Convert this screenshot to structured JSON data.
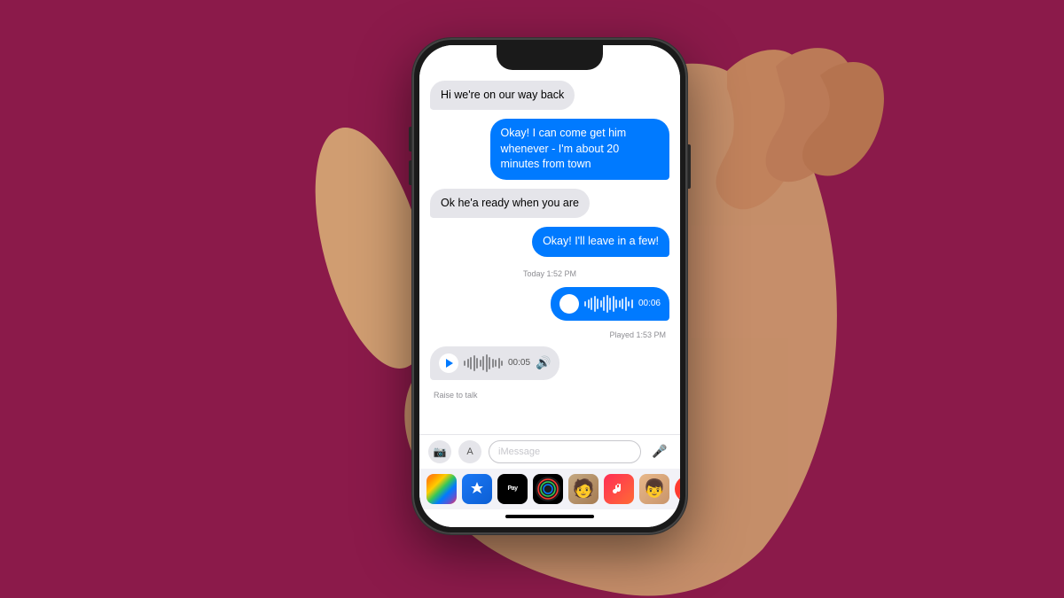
{
  "background": {
    "color": "#8B1A4A"
  },
  "phone": {
    "messages": [
      {
        "id": "msg1",
        "type": "incoming",
        "text": "Hi we're on our way back"
      },
      {
        "id": "msg2",
        "type": "outgoing",
        "text": "Okay! I can come get him whenever - I'm about 20 minutes from town"
      },
      {
        "id": "msg3",
        "type": "incoming",
        "text": "Ok he'a ready when you are"
      },
      {
        "id": "msg4",
        "type": "outgoing",
        "text": "Okay! I'll leave in a few!"
      }
    ],
    "timestamp": "Today 1:52 PM",
    "audio_outgoing": {
      "time": "00:06",
      "played": "Played 1:53 PM"
    },
    "audio_incoming": {
      "time": "00:05"
    },
    "raise_to_talk": "Raise to talk",
    "input_placeholder": "iMessage",
    "app_strip": [
      "photos",
      "appstore",
      "applepay",
      "fitness",
      "memoji1",
      "music",
      "memoji2",
      "red"
    ]
  }
}
